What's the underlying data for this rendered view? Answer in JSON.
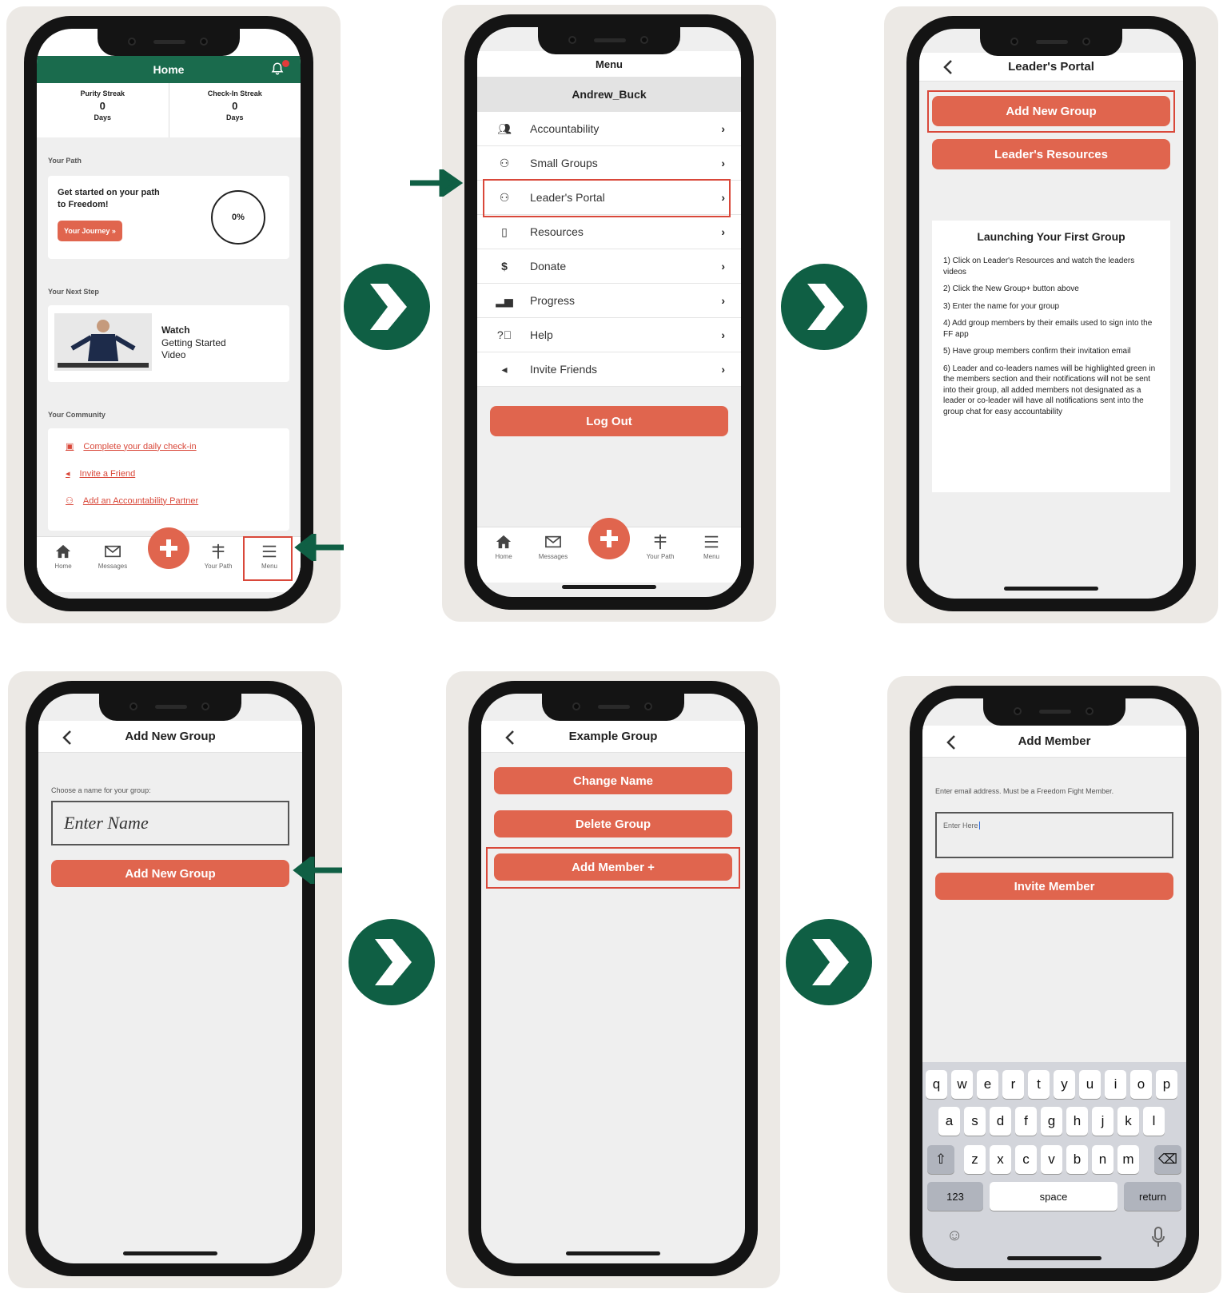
{
  "panel1": {
    "header_title": "Home",
    "purity_label": "Purity Streak",
    "purity_value": "0",
    "purity_unit": "Days",
    "checkin_label": "Check-In Streak",
    "checkin_value": "0",
    "checkin_unit": "Days",
    "your_path_label": "Your Path",
    "path_card_text": "Get started on your path to Freedom!",
    "journey_button": "Your Journey »",
    "progress_percent": "0%",
    "next_step_label": "Your Next Step",
    "video_watch": "Watch",
    "video_title": "Getting Started Video",
    "community_label": "Your Community",
    "community_links": [
      "Complete your daily check-in",
      "Invite a Friend",
      "Add an Accountability Partner"
    ],
    "tabs": [
      "Home",
      "Messages",
      "Your Path",
      "Menu"
    ]
  },
  "panel2": {
    "header_title": "Menu",
    "username": "Andrew_Buck",
    "menu_items": [
      "Accountability",
      "Small Groups",
      "Leader's Portal",
      "Resources",
      "Donate",
      "Progress",
      "Help",
      "Invite Friends"
    ],
    "logout_button": "Log Out",
    "tabs": [
      "Home",
      "Messages",
      "Your Path",
      "Menu"
    ]
  },
  "panel3": {
    "header_title": "Leader's Portal",
    "add_group_button": "Add New Group",
    "resources_button": "Leader's Resources",
    "instructions_title": "Launching Your First Group",
    "steps": [
      "1) Click on Leader's Resources and watch the leaders videos",
      "2) Click the New Group+ button above",
      "3) Enter the name for your group",
      "4) Add group members by their emails used to sign into the FF app",
      "5) Have group members confirm their invitation email",
      "6) Leader and co-leaders names will be highlighted green in the members section and their notifications will not be sent into their group, all added members not designated as a leader or co-leader will have all notifications sent into the group chat for easy accountability"
    ]
  },
  "panel4": {
    "header_title": "Add New Group",
    "prompt": "Choose a name for your group:",
    "input_placeholder": "Enter Name",
    "submit_button": "Add New Group"
  },
  "panel5": {
    "header_title": "Example Group",
    "change_name_button": "Change Name",
    "delete_button": "Delete Group",
    "add_member_button": "Add Member +"
  },
  "panel6": {
    "header_title": "Add Member",
    "prompt": "Enter email address. Must be a Freedom Fight Member.",
    "input_value": "Enter Here",
    "invite_button": "Invite Member",
    "keyboard_row1": [
      "q",
      "w",
      "e",
      "r",
      "t",
      "y",
      "u",
      "i",
      "o",
      "p"
    ],
    "keyboard_row2": [
      "a",
      "s",
      "d",
      "f",
      "g",
      "h",
      "j",
      "k",
      "l"
    ],
    "keyboard_row3": [
      "z",
      "x",
      "c",
      "v",
      "b",
      "n",
      "m"
    ],
    "key_numbers": "123",
    "key_space": "space",
    "key_return": "return"
  },
  "colors": {
    "brand_green": "#1a6b4d",
    "accent": "#e0654e",
    "highlight": "#d9483a",
    "next_circle": "#0f5f44"
  }
}
